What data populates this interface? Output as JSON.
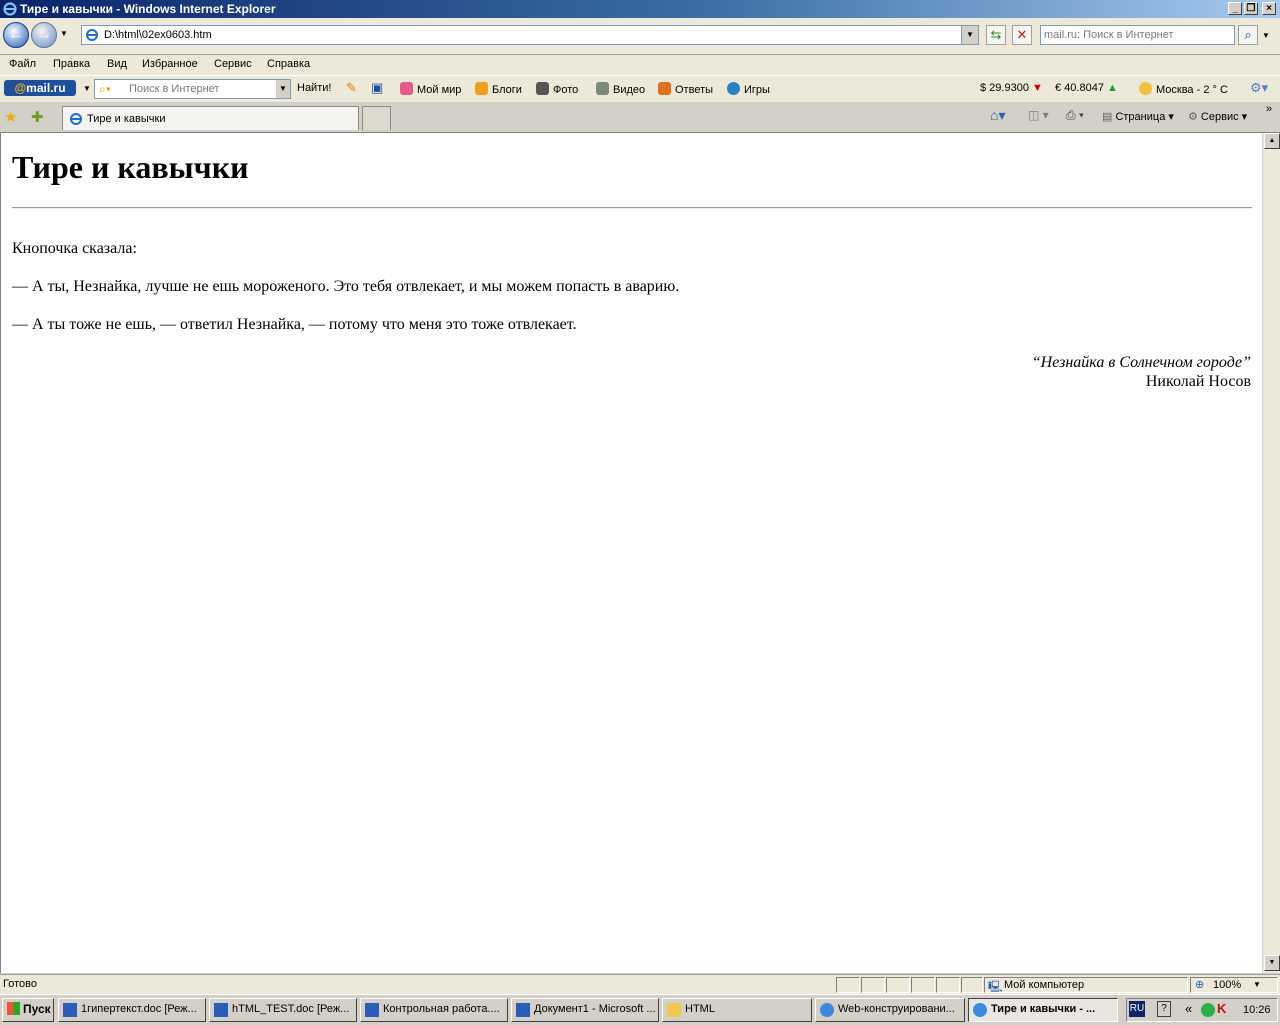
{
  "window": {
    "title": "Тире и кавычки - Windows Internet Explorer"
  },
  "address": {
    "url": "D:\\html\\02ex0603.htm"
  },
  "search": {
    "placeholder": "mail.ru: Поиск в Интернет"
  },
  "menu": [
    "Файл",
    "Правка",
    "Вид",
    "Избранное",
    "Сервис",
    "Справка"
  ],
  "mailru": {
    "logo_prefix": "@",
    "logo_text": "mail.ru",
    "search_placeholder": "Поиск в Интернет",
    "find_label": "Найти!",
    "links": [
      "Мой мир",
      "Блоги",
      "Фото",
      "Видео",
      "Ответы",
      "Игры"
    ],
    "usd": "$ 29.9300",
    "eur": "€ 40.8047",
    "weather": "Москва  - 2 ° C"
  },
  "tabs": {
    "active_label": "Тире и кавычки"
  },
  "commands": {
    "page": "Страница",
    "tools": "Сервис"
  },
  "content": {
    "heading": "Тире и кавычки",
    "paragraphs": [
      "Кнопочка сказала:",
      "— А ты, Незнайка, лучше не ешь мороженого. Это тебя отвлекает, и мы можем попасть в аварию.",
      "— А ты тоже не ешь, — ответил Незнайка, — потому что меня это тоже отвлекает."
    ],
    "citation_title": "“Незнайка в Солнечном городе”",
    "citation_author": "Николай Носов"
  },
  "status": {
    "text": "Готово",
    "zone": "Мой компьютер",
    "zoom": "100%"
  },
  "taskbar": {
    "start": "Пуск",
    "tasks": [
      "1гипертекст.doc [Реж...",
      "hTML_TEST.doc [Реж...",
      "Контрольная работа....",
      "Документ1 - Microsoft ...",
      "HTML",
      "Web-конструировани...",
      "Тире и кавычки - ..."
    ],
    "lang": "RU",
    "clock": "10:26",
    "chevron": "«",
    "help": "?"
  },
  "colors": {
    "titlebar": "#0a246a",
    "accent": "#1e4f9c",
    "down": "#e00000",
    "up": "#22a022"
  }
}
